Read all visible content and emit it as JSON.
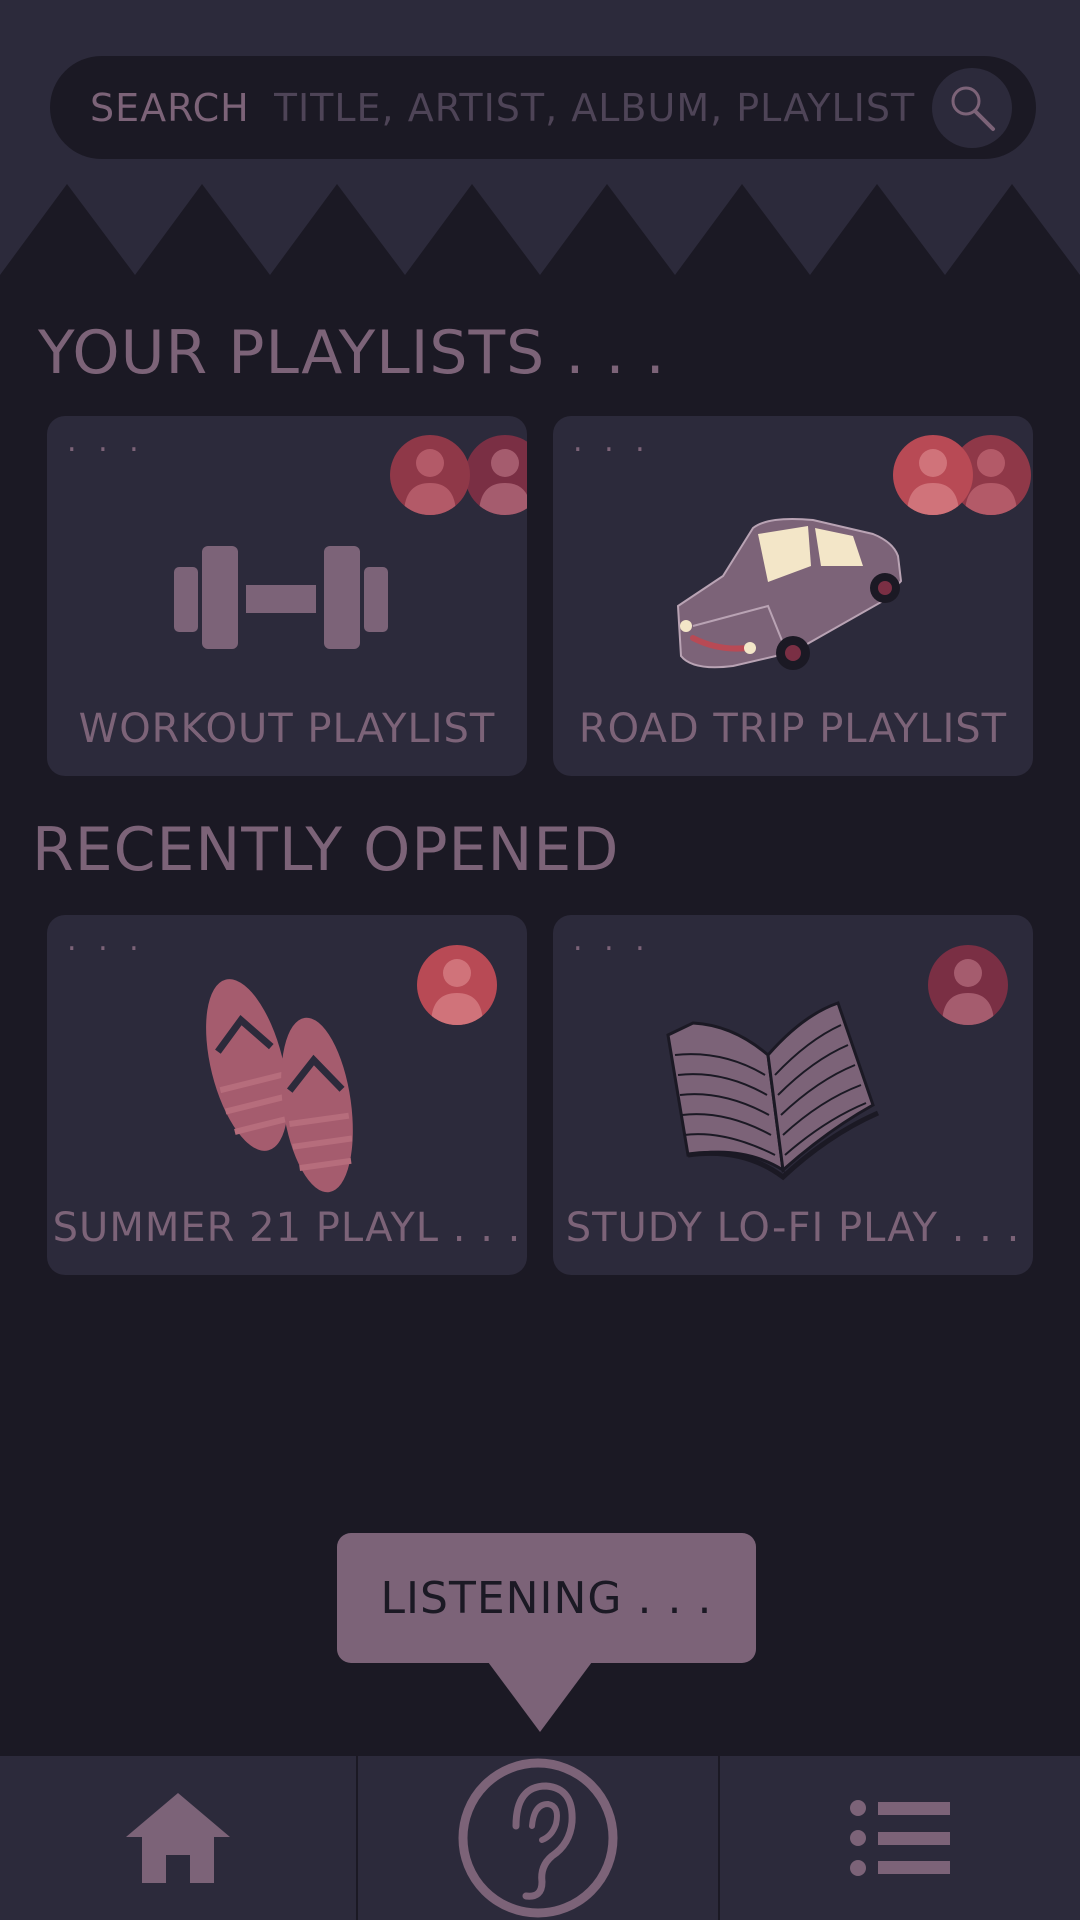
{
  "colors": {
    "background": "#1b1924",
    "surface": "#2c2a3b",
    "accent": "#7c6378",
    "avatar_red": "#b84a55",
    "avatar_dark": "#7a2f44"
  },
  "search": {
    "label": "SEARCH",
    "placeholder": "TITLE, ARTIST, ALBUM, PLAYLIST",
    "icon": "magnifier-icon"
  },
  "playlists_section": {
    "title": "YOUR PLAYLISTS . . .",
    "items": [
      {
        "label": "WORKOUT PLAYLIST",
        "menu": ". . .",
        "icon": "dumbbell-icon"
      },
      {
        "label": "ROAD TRIP PLAYLIST",
        "menu": ". . .",
        "icon": "car-icon"
      }
    ]
  },
  "recent_section": {
    "title": "RECENTLY OPENED",
    "items": [
      {
        "label": "SUMMER 21 PLAYL . . .",
        "menu": ". . .",
        "icon": "flip-flops-icon"
      },
      {
        "label": "STUDY LO-FI PLAY . . .",
        "menu": ". . .",
        "icon": "book-icon"
      }
    ]
  },
  "tooltip": {
    "text": "LISTENING . . ."
  },
  "nav": {
    "items": [
      {
        "name": "home",
        "icon": "home-icon"
      },
      {
        "name": "listen",
        "icon": "ear-icon"
      },
      {
        "name": "list",
        "icon": "list-icon"
      }
    ]
  }
}
